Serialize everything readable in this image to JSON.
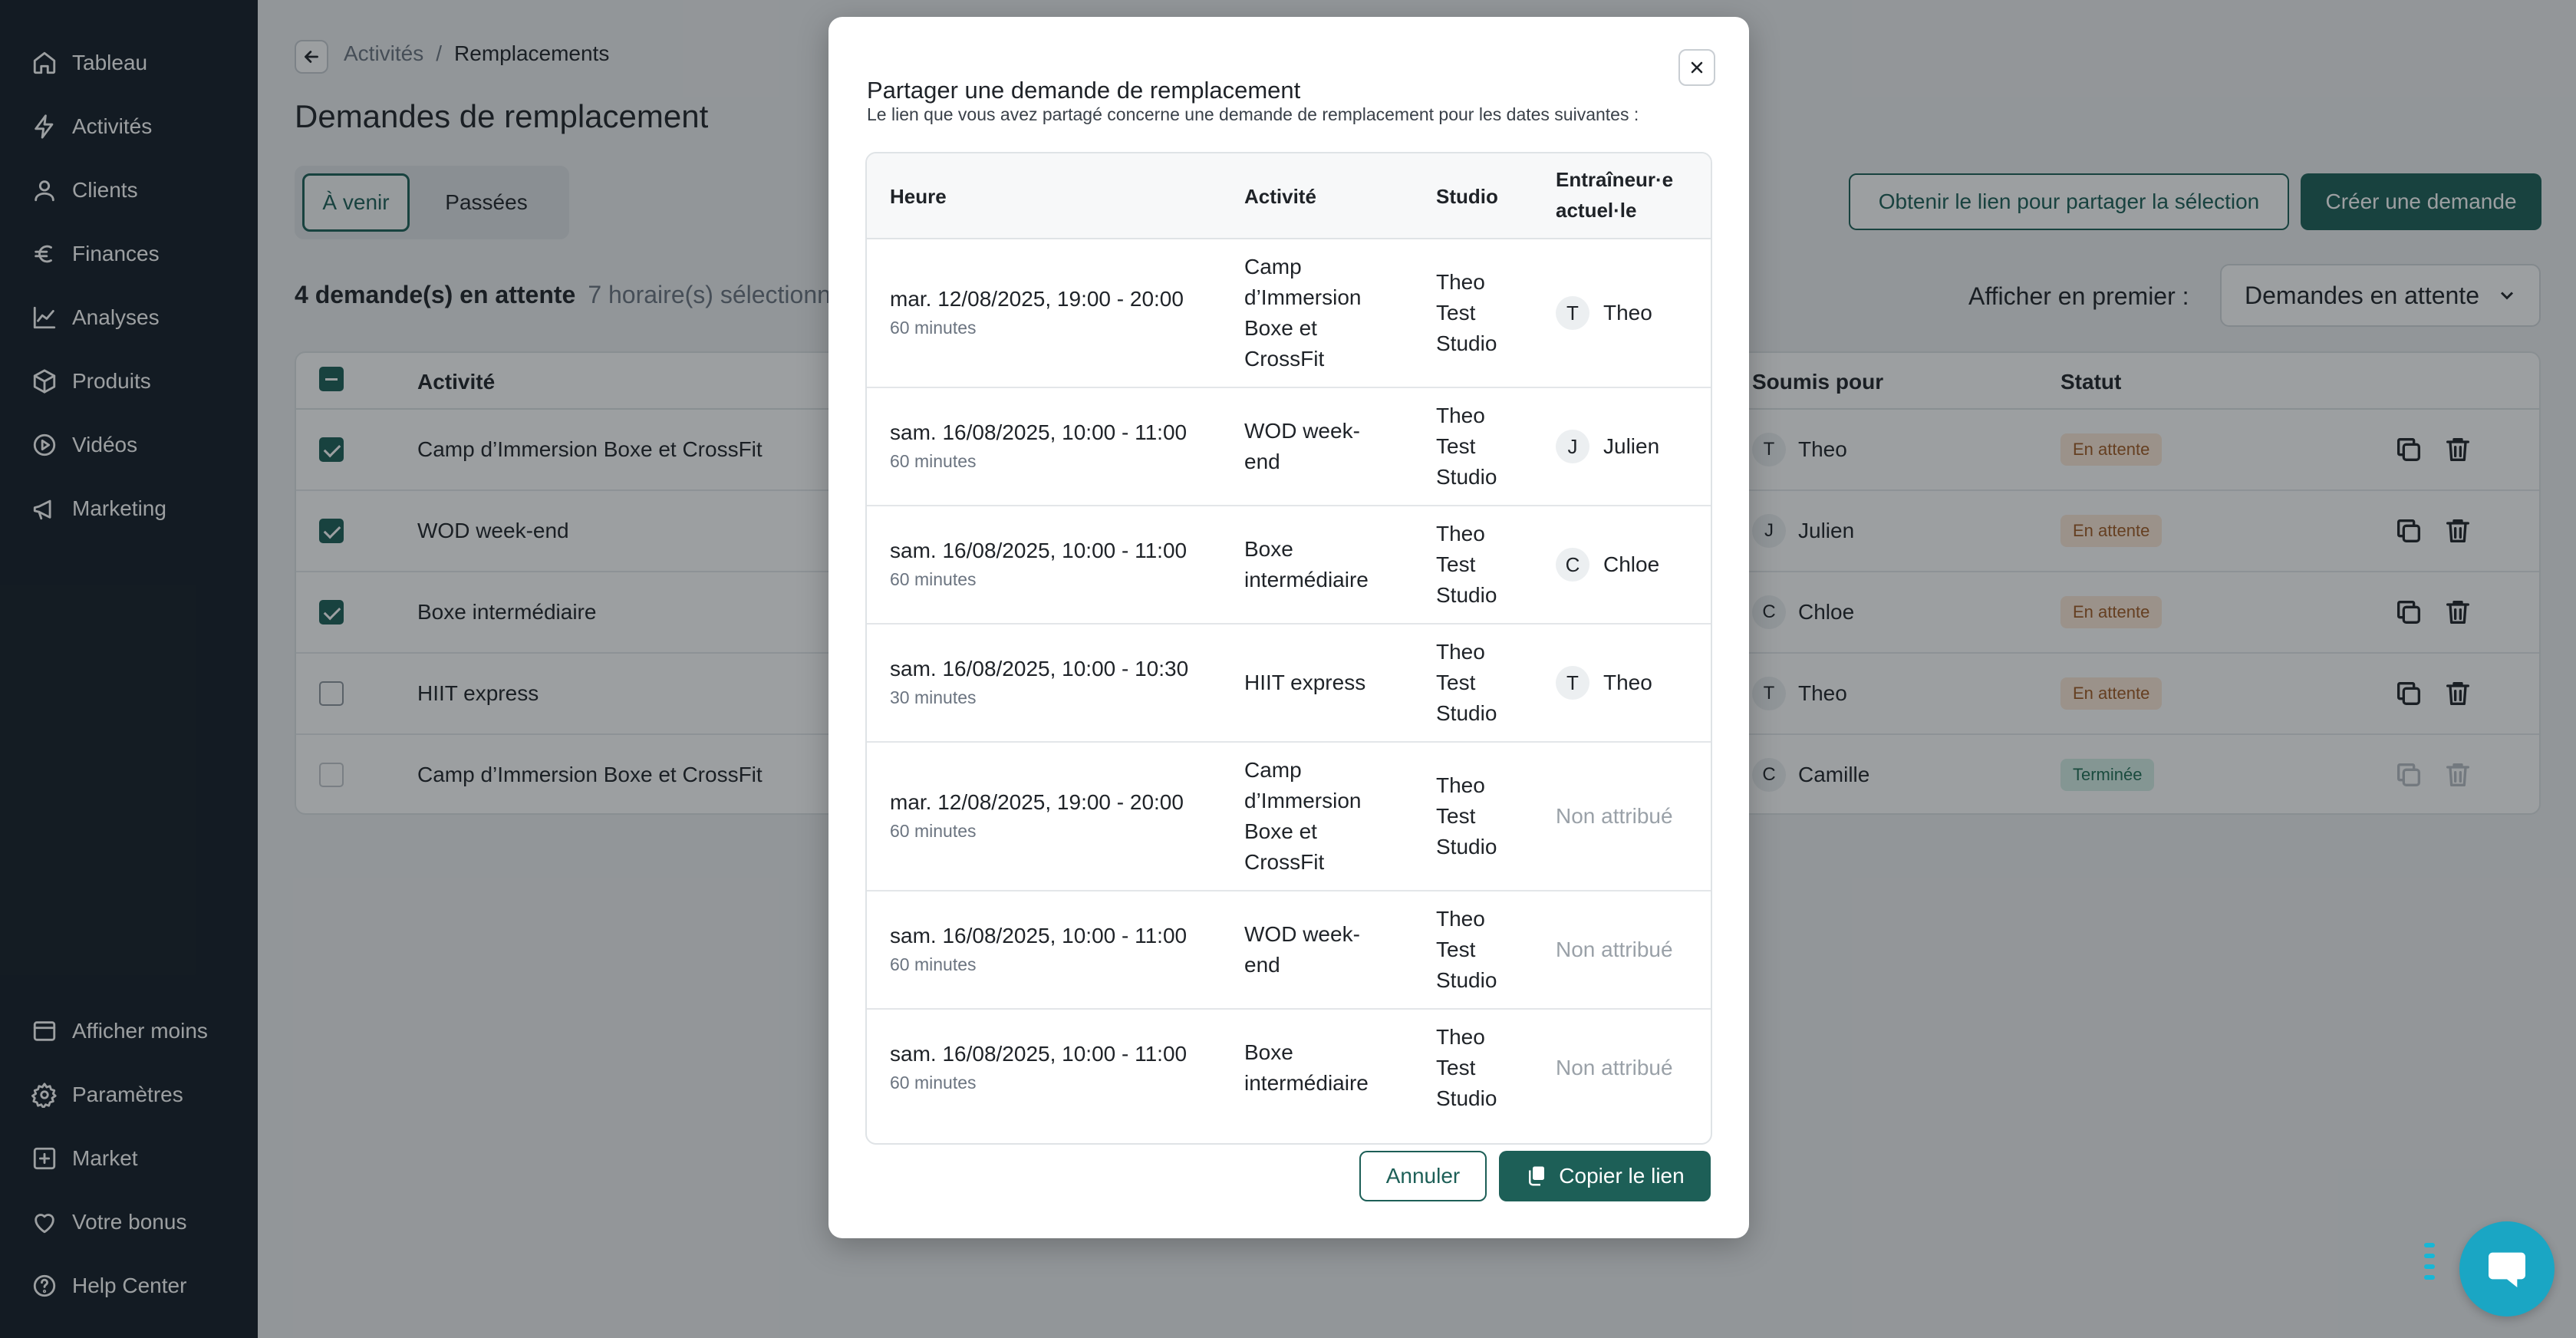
{
  "sidebar": {
    "items": [
      {
        "label": "Tableau",
        "icon": "home-icon"
      },
      {
        "label": "Activités",
        "icon": "bolt-icon"
      },
      {
        "label": "Clients",
        "icon": "user-icon"
      },
      {
        "label": "Finances",
        "icon": "euro-icon"
      },
      {
        "label": "Analyses",
        "icon": "chart-line-icon"
      },
      {
        "label": "Produits",
        "icon": "box-icon"
      },
      {
        "label": "Vidéos",
        "icon": "play-circle-icon"
      },
      {
        "label": "Marketing",
        "icon": "megaphone-icon"
      }
    ],
    "bottom_items": [
      {
        "label": "Afficher moins",
        "icon": "collapse-icon"
      },
      {
        "label": "Paramètres",
        "icon": "gear-icon"
      },
      {
        "label": "Market",
        "icon": "plus-square-icon"
      },
      {
        "label": "Votre bonus",
        "icon": "heart-icon"
      },
      {
        "label": "Help Center",
        "icon": "help-circle-icon"
      }
    ]
  },
  "header": {
    "breadcrumb_parent": "Activités",
    "breadcrumb_separator": "/",
    "breadcrumb_current": "Remplacements",
    "title": "Demandes de remplacement"
  },
  "tabs": {
    "upcoming": "À venir",
    "past": "Passées"
  },
  "summary": {
    "pending": "4 demande(s) en attente",
    "selected": "7 horaire(s) sélectionn"
  },
  "actions": {
    "share_selection": "Obtenir le lien pour partager la sélection",
    "create": "Créer une demande",
    "sort_label": "Afficher en premier :",
    "sort_value": "Demandes en attente"
  },
  "table": {
    "headers": {
      "activity": "Activité",
      "submitted_for": "Soumis pour",
      "status": "Statut"
    },
    "rows": [
      {
        "activity": "Camp d’Immersion Boxe et CrossFit",
        "initial": "T",
        "name": "Theo",
        "status": "En attente"
      },
      {
        "activity": "WOD week-end",
        "initial": "J",
        "name": "Julien",
        "status": "En attente"
      },
      {
        "activity": "Boxe intermédiaire",
        "initial": "C",
        "name": "Chloe",
        "status": "En attente"
      },
      {
        "activity": "HIIT express",
        "initial": "T",
        "name": "Theo",
        "status": "En attente"
      },
      {
        "activity": "Camp d’Immersion Boxe et CrossFit",
        "initial": "C",
        "name": "Camille",
        "status": "Terminée"
      }
    ]
  },
  "modal": {
    "title": "Partager une demande de remplacement",
    "subtitle": "Le lien que vous avez partagé concerne une demande de remplacement pour les dates suivantes :",
    "headers": {
      "time": "Heure",
      "activity": "Activité",
      "studio": "Studio",
      "trainer": "Entraîneur·e actuel·le"
    },
    "rows": [
      {
        "time": "mar. 12/08/2025, 19:00 - 20:00",
        "duration": "60 minutes",
        "activity": "Camp d’Immersion Boxe et CrossFit",
        "studio": "Theo Test Studio",
        "initial": "T",
        "trainer": "Theo"
      },
      {
        "time": "sam. 16/08/2025, 10:00 - 11:00",
        "duration": "60 minutes",
        "activity": "WOD week-end",
        "studio": "Theo Test Studio",
        "initial": "J",
        "trainer": "Julien"
      },
      {
        "time": "sam. 16/08/2025, 10:00 - 11:00",
        "duration": "60 minutes",
        "activity": "Boxe intermédiaire",
        "studio": "Theo Test Studio",
        "initial": "C",
        "trainer": "Chloe"
      },
      {
        "time": "sam. 16/08/2025, 10:00 - 10:30",
        "duration": "30 minutes",
        "activity": "HIIT express",
        "studio": "Theo Test Studio",
        "initial": "T",
        "trainer": "Theo"
      },
      {
        "time": "mar. 12/08/2025, 19:00 - 20:00",
        "duration": "60 minutes",
        "activity": "Camp d’Immersion Boxe et CrossFit",
        "studio": "Theo Test Studio",
        "unassigned": "Non attribué"
      },
      {
        "time": "sam. 16/08/2025, 10:00 - 11:00",
        "duration": "60 minutes",
        "activity": "WOD week-end",
        "studio": "Theo Test Studio",
        "unassigned": "Non attribué"
      },
      {
        "time": "sam. 16/08/2025, 10:00 - 11:00",
        "duration": "60 minutes",
        "activity": "Boxe intermédiaire",
        "studio": "Theo Test Studio",
        "unassigned": "Non attribué"
      }
    ],
    "cancel": "Annuler",
    "copy": "Copier le lien"
  },
  "colors": {
    "brand": "#1d5f57",
    "sidebar": "#141d26",
    "chat": "#1aa6c4"
  }
}
